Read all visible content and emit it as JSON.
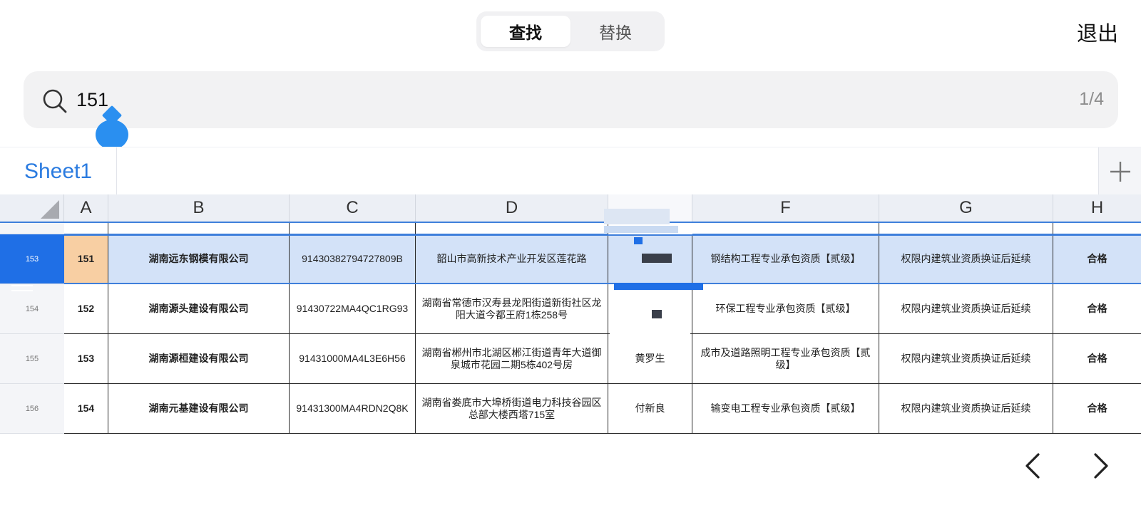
{
  "top_tabs": [
    {
      "label": "查找",
      "active": true
    },
    {
      "label": "替换",
      "active": false
    }
  ],
  "exit_label": "退出",
  "search": {
    "value": "151",
    "match_count": "1/4",
    "icon": "search-icon"
  },
  "sheet": {
    "tab_label": "Sheet1",
    "add_icon": "plus-icon"
  },
  "grid": {
    "columns": [
      "A",
      "B",
      "C",
      "D",
      "",
      "F",
      "G",
      "H"
    ],
    "rows": [
      {
        "row_number": "153",
        "cells": [
          "151",
          "湖南远东钢模有限公司",
          "91430382794727809B",
          "韶山市高新技术产业开发区莲花路",
          "",
          "钢结构工程专业承包资质【贰级】",
          "权限内建筑业资质换证后延续",
          "合格"
        ],
        "selected": true
      },
      {
        "row_number": "154",
        "cells": [
          "152",
          "湖南源头建设有限公司",
          "91430722MA4QC1RG93",
          "湖南省常德市汉寿县龙阳街道新街社区龙阳大道今都王府1栋258号",
          "",
          "环保工程专业承包资质【贰级】",
          "权限内建筑业资质换证后延续",
          "合格"
        ],
        "selected": false
      },
      {
        "row_number": "155",
        "cells": [
          "153",
          "湖南源桓建设有限公司",
          "91431000MA4L3E6H56",
          "湖南省郴州市北湖区郴江街道青年大道御泉城市花园二期5栋402号房",
          "黄罗生",
          "成市及道路照明工程专业承包资质【贰级】",
          "权限内建筑业资质换证后延续",
          "合格"
        ],
        "selected": false
      },
      {
        "row_number": "156",
        "cells": [
          "154",
          "湖南元基建设有限公司",
          "91431300MA4RDN2Q8K",
          "湖南省娄底市大埠桥街道电力科技谷园区总部大楼西塔715室",
          "付新良",
          "输变电工程专业承包资质【贰级】",
          "权限内建筑业资质换证后延续",
          "合格"
        ],
        "selected": false
      }
    ]
  },
  "nav": {
    "prev_icon": "chevron-left-icon",
    "next_icon": "chevron-right-icon"
  },
  "colors": {
    "accent": "#2a7be0",
    "selection_fill": "#d3e2f8",
    "active_cell": "#f8cfa3",
    "selection_border": "#3e7fdb"
  }
}
